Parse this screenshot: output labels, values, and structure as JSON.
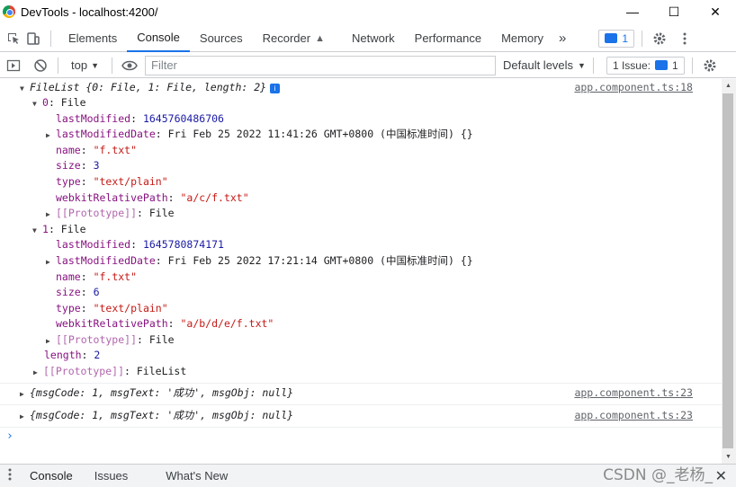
{
  "window": {
    "title": "DevTools - localhost:4200/",
    "minimize": "—",
    "maximize": "☐",
    "close": "✕"
  },
  "tabs": [
    "Elements",
    "Console",
    "Sources",
    "Recorder",
    "Network",
    "Performance",
    "Memory"
  ],
  "tabs_more": "»",
  "messages_count": "1",
  "console_toolbar": {
    "context": "top",
    "filter_placeholder": "Filter",
    "levels": "Default levels",
    "issues": "1 Issue:",
    "issues_count": "1"
  },
  "entries": [
    {
      "summary_key": "FileList",
      "summary_body": " {0: File, 1: File, length: 2}",
      "source": "app.component.ts:18"
    }
  ],
  "tree": {
    "f0_label": "0",
    "f0_type": "File",
    "f0_lastModified": "1645760486706",
    "f0_lastModifiedDate": "Fri Feb 25 2022 11:41:26 GMT+0800 (中国标准时间) {}",
    "f0_name": "\"f.txt\"",
    "f0_size": "3",
    "f0_type_val": "\"text/plain\"",
    "f0_path": "\"a/c/f.txt\"",
    "f1_label": "1",
    "f1_type": "File",
    "f1_lastModified": "1645780874171",
    "f1_lastModifiedDate": "Fri Feb 25 2022 17:21:14 GMT+0800 (中国标准时间) {}",
    "f1_name": "\"f.txt\"",
    "f1_size": "6",
    "f1_type_val": "\"text/plain\"",
    "f1_path": "\"a/b/d/e/f.txt\"",
    "length_val": "2",
    "proto_file": "File",
    "proto_filelist": "FileList",
    "key_lastModified": "lastModified",
    "key_lastModifiedDate": "lastModifiedDate",
    "key_name": "name",
    "key_size": "size",
    "key_type": "type",
    "key_path": "webkitRelativePath",
    "key_proto": "[[Prototype]]",
    "key_length": "length"
  },
  "log2": {
    "pre": "{msgCode: 1, msgText: ",
    "str": "'成功'",
    "post": ", msgObj: null}",
    "source": "app.component.ts:23"
  },
  "log3": {
    "pre": "{msgCode: 1, msgText: ",
    "str": "'成功'",
    "post": ", msgObj: null}",
    "source": "app.component.ts:23"
  },
  "drawer": {
    "tabs": [
      "Console",
      "Issues",
      "What's New"
    ]
  },
  "watermark": "CSDN @_老杨_"
}
